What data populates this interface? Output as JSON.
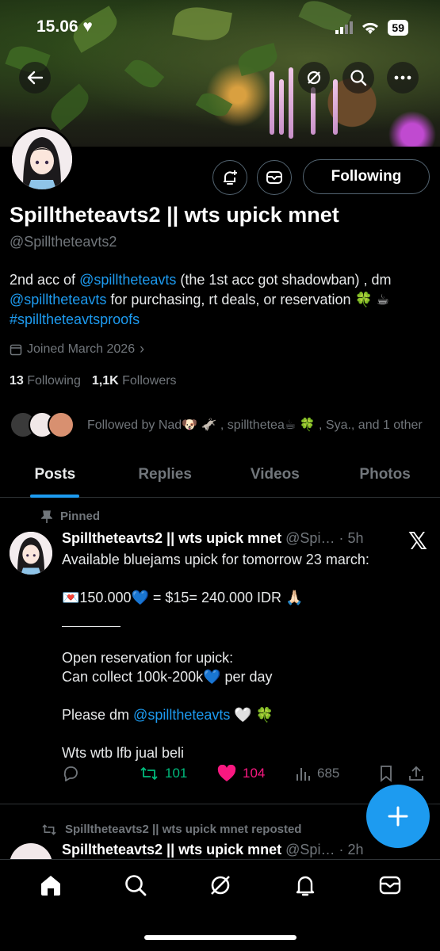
{
  "status": {
    "time": "15.06",
    "battery": "59"
  },
  "profile": {
    "name": "Spilltheteavts2 || wts upick mnet",
    "handle": "@Spilltheteavts2",
    "bio": {
      "p1": "2nd acc of ",
      "link1": "@spilltheteavts",
      "p2": " (the 1st acc got shadowban) , dm ",
      "link2": "@spilltheteavts",
      "p3": " for purchasing, rt deals, or reservation 🍀 ☕",
      "hashtag": "#spilltheteavtsproofs"
    },
    "joined": "Joined March 2026",
    "following_count": "13",
    "following_label": "Following",
    "followers_count": "1,1K",
    "followers_label": "Followers",
    "followed_by": "Followed by Nad🐶 🫏 , spillthetea☕ 🍀 , Sya., and 1 other",
    "following_button": "Following"
  },
  "tabs": [
    "Posts",
    "Replies",
    "Videos",
    "Photos"
  ],
  "post": {
    "pinned_label": "Pinned",
    "author": "Spilltheteavts2 || wts upick mnet",
    "meta": " @Spi… · 5h",
    "lines": {
      "l1": "Available bluejams upick for tomorrow 23 march:",
      "l2": "💌150.000💙 = $15= 240.000 IDR 🙏🏻",
      "l3": "Open reservation for upick:",
      "l4": "Can collect 100k-200k💙 per day",
      "l5a": "Please dm ",
      "l5link": "@spilltheteavts",
      "l5b": " 🤍 🍀",
      "l6": "Wts wtb lfb jual beli"
    },
    "retweets": "101",
    "likes": "104",
    "views": "685"
  },
  "post2": {
    "repost_label": "Spilltheteavts2 || wts upick mnet reposted",
    "author": "Spilltheteavts2 || wts upick mnet",
    "meta": " @Spi… · 2h"
  },
  "colors": {
    "accent": "#1d9bf0",
    "like": "#f91880",
    "retweet": "#00ba7c",
    "muted": "#71767b"
  }
}
